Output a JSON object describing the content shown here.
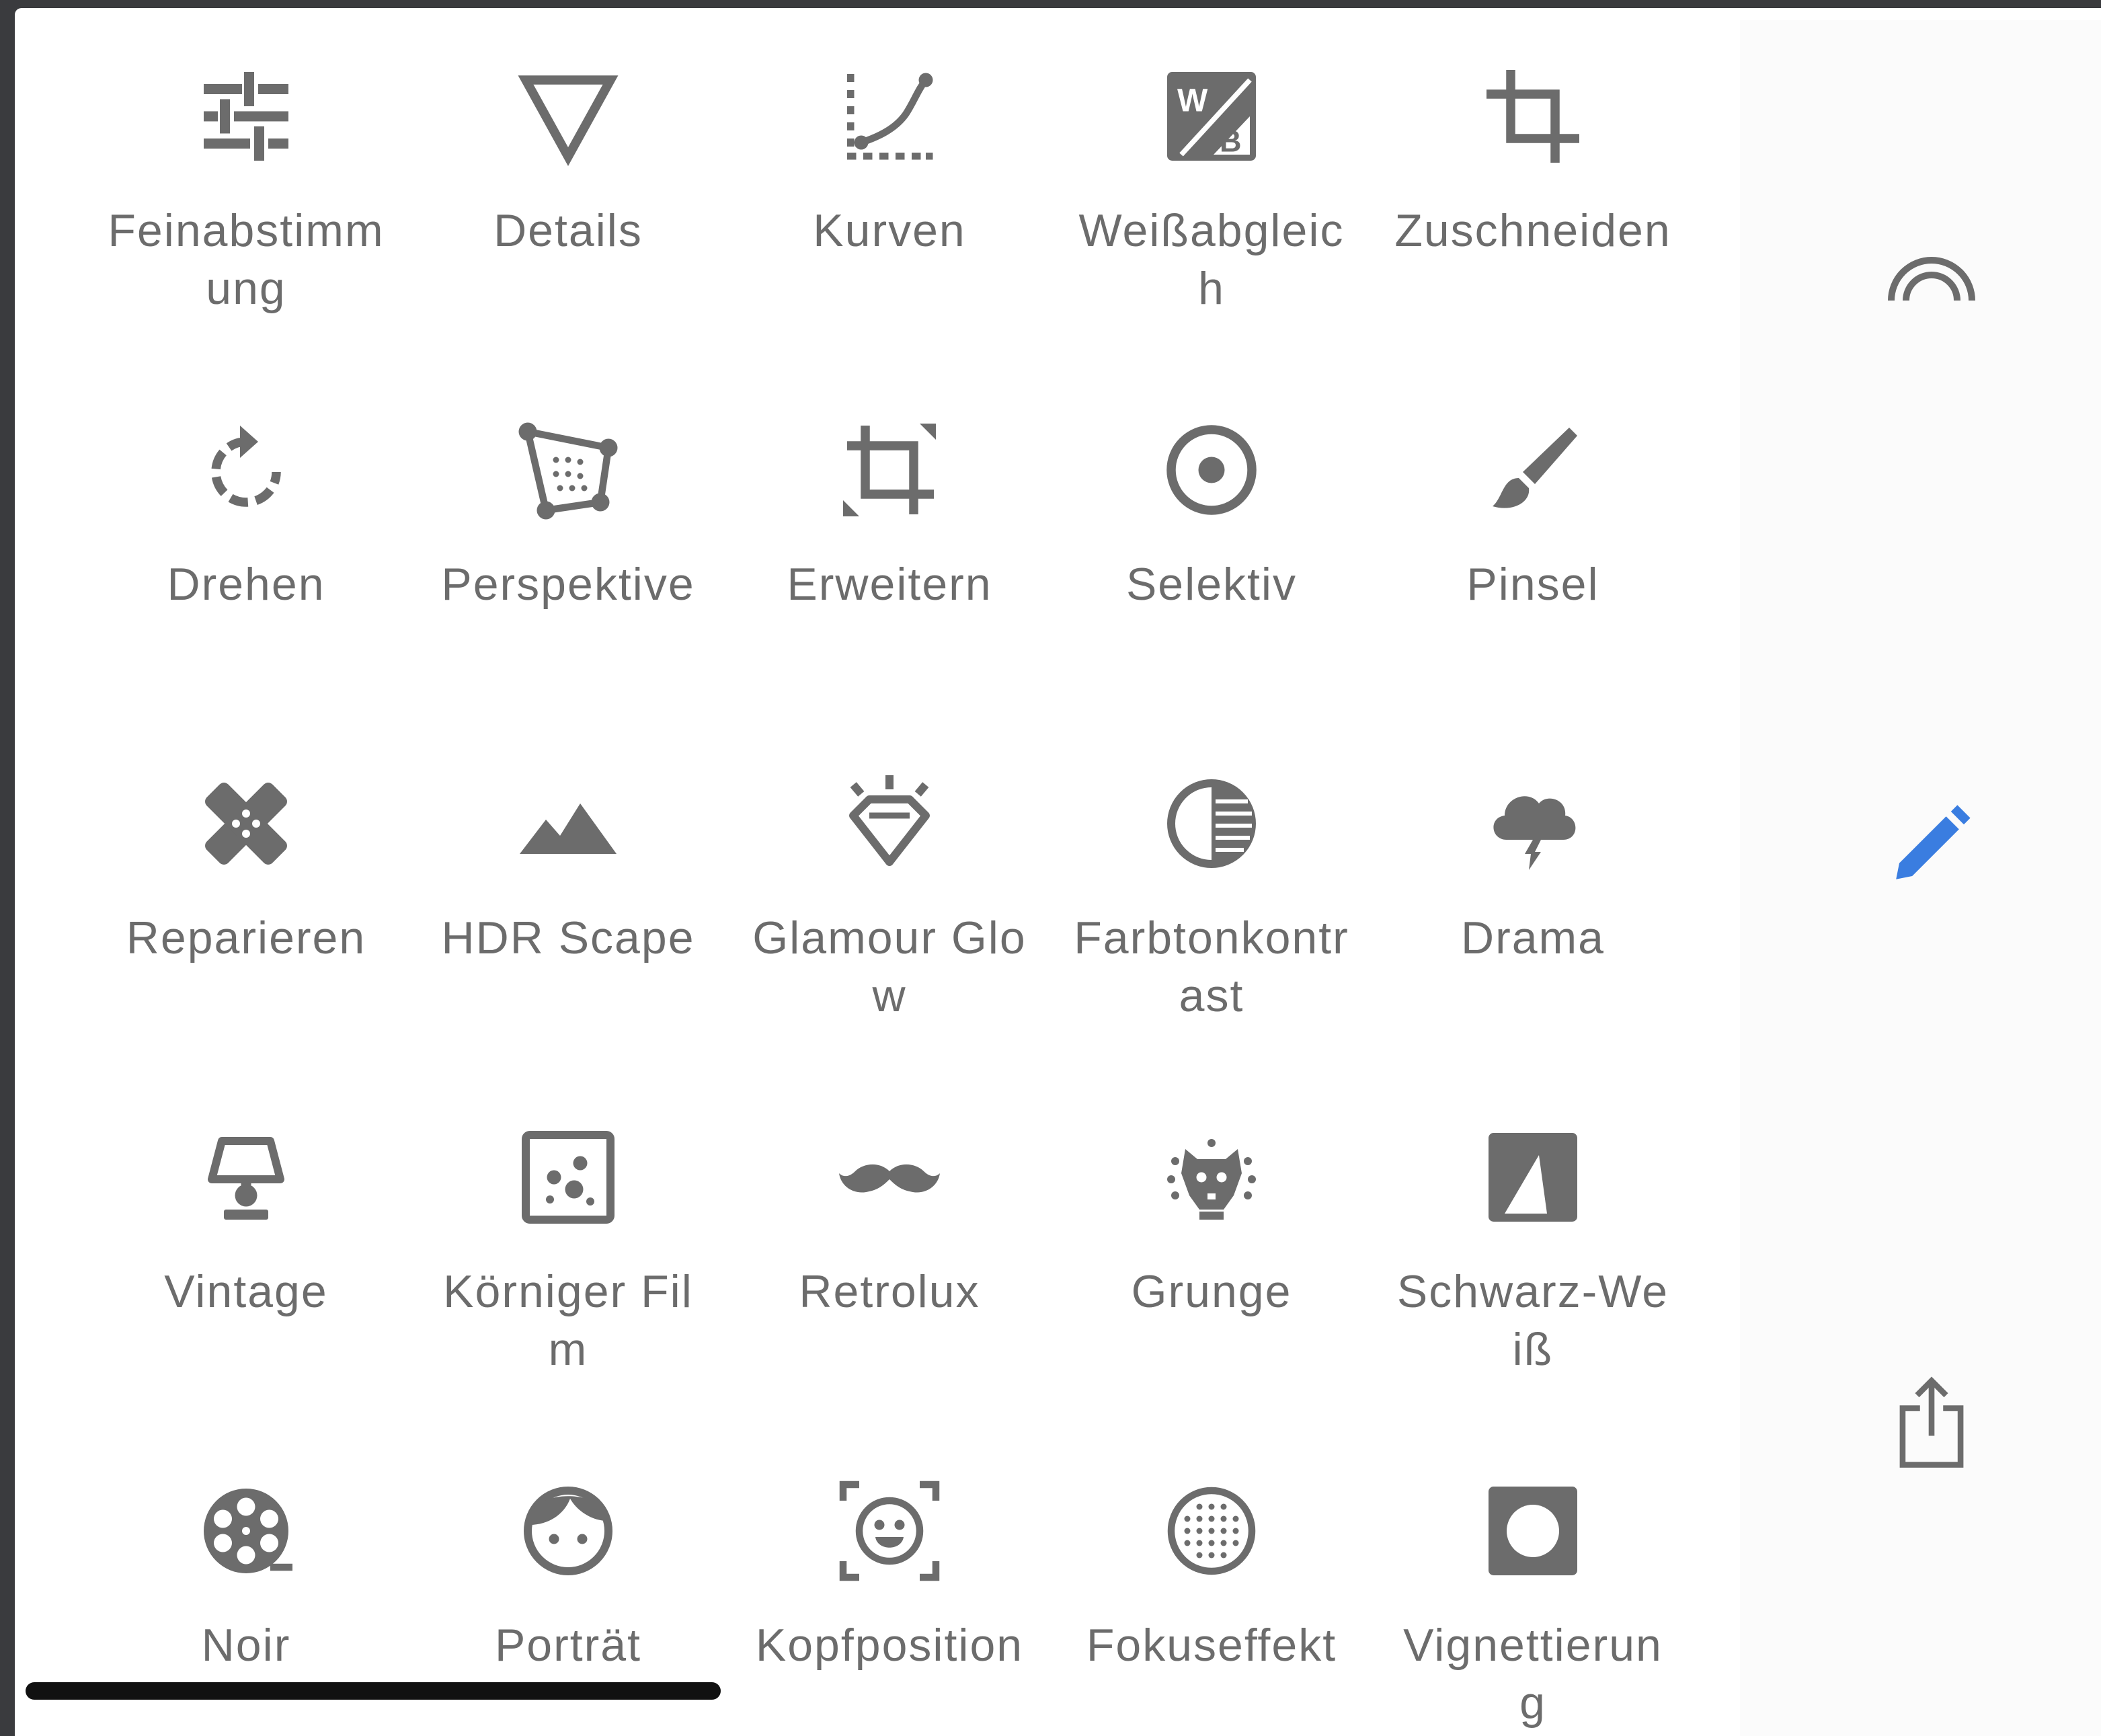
{
  "sidebar": {
    "looks_icon": "looks-arc-icon",
    "tools_icon": "pencil-icon",
    "export_icon": "share-icon",
    "active_color": "#3a7de0"
  },
  "tools": [
    {
      "label": "Feinabstimmung",
      "icon": "tune-sliders-icon"
    },
    {
      "label": "Details",
      "icon": "triangle-icon"
    },
    {
      "label": "Kurven",
      "icon": "curves-icon"
    },
    {
      "label": "Weißabgleich",
      "icon": "white-balance-icon"
    },
    {
      "label": "Zuschneiden",
      "icon": "crop-icon"
    },
    {
      "label": "Drehen",
      "icon": "rotate-icon"
    },
    {
      "label": "Perspektive",
      "icon": "perspective-icon"
    },
    {
      "label": "Erweitern",
      "icon": "expand-icon"
    },
    {
      "label": "Selektiv",
      "icon": "selective-icon"
    },
    {
      "label": "Pinsel",
      "icon": "brush-icon"
    },
    {
      "label": "Reparieren",
      "icon": "bandage-icon"
    },
    {
      "label": "HDR Scape",
      "icon": "mountains-icon"
    },
    {
      "label": "Glamour Glow",
      "icon": "diamond-icon"
    },
    {
      "label": "Farbtonkontrast",
      "icon": "tonal-contrast-icon"
    },
    {
      "label": "Drama",
      "icon": "storm-cloud-icon"
    },
    {
      "label": "Vintage",
      "icon": "lamp-icon"
    },
    {
      "label": "Körniger Film",
      "icon": "film-grain-icon"
    },
    {
      "label": "Retrolux",
      "icon": "mustache-icon"
    },
    {
      "label": "Grunge",
      "icon": "grunge-icon"
    },
    {
      "label": "Schwarz-Weiß",
      "icon": "black-white-icon"
    },
    {
      "label": "Noir",
      "icon": "film-reel-icon"
    },
    {
      "label": "Porträt",
      "icon": "face-icon"
    },
    {
      "label": "Kopfposition",
      "icon": "head-pose-icon"
    },
    {
      "label": "Fokuseffekt",
      "icon": "lens-blur-icon"
    },
    {
      "label": "Vignettierung",
      "icon": "vignette-icon"
    }
  ],
  "colors": {
    "icon": "#6c6c6c",
    "label": "#6c6c6c"
  }
}
